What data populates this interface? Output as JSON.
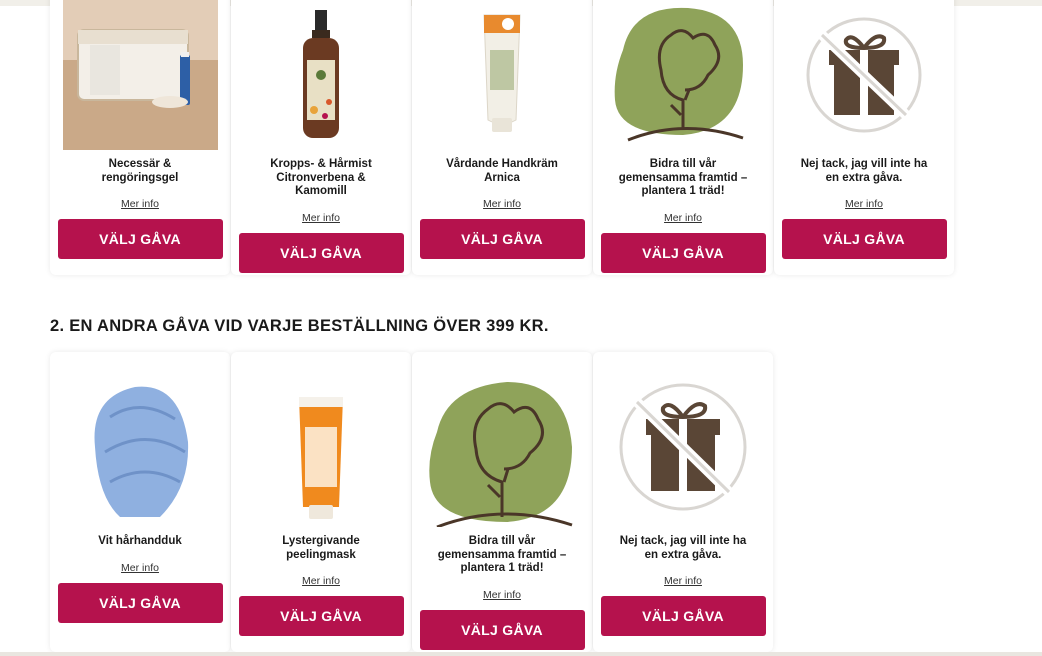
{
  "section1": {
    "products": [
      {
        "name": "Necessär & rengöringsgel",
        "more": "Mer info",
        "button": "VÄLJ GÅVA",
        "icon": "toiletry-bag-image"
      },
      {
        "name": "Kropps- & Hårmist Citronverbena & Kamomill",
        "more": "Mer info",
        "button": "VÄLJ GÅVA",
        "icon": "spray-bottle-image"
      },
      {
        "name": "Vårdande Handkräm Arnica",
        "more": "Mer info",
        "button": "VÄLJ GÅVA",
        "icon": "hand-cream-tube-image"
      },
      {
        "name": "Bidra till vår gemensamma framtid – plantera 1 träd!",
        "more": "Mer info",
        "button": "VÄLJ GÅVA",
        "icon": "tree-icon"
      },
      {
        "name": "Nej tack, jag vill inte ha en extra gåva.",
        "more": "Mer info",
        "button": "VÄLJ GÅVA",
        "icon": "no-gift-icon"
      }
    ]
  },
  "section2": {
    "title": "2. EN ANDRA GÅVA VID VARJE BESTÄLLNING ÖVER 399 KR.",
    "products": [
      {
        "name": "Vit hårhandduk",
        "more": "Mer info",
        "button": "VÄLJ GÅVA",
        "icon": "hair-towel-image"
      },
      {
        "name": "Lystergivande peelingmask",
        "more": "Mer info",
        "button": "VÄLJ GÅVA",
        "icon": "peeling-mask-tube-image"
      },
      {
        "name": "Bidra till vår gemensamma framtid – plantera 1 träd!",
        "more": "Mer info",
        "button": "VÄLJ GÅVA",
        "icon": "tree-icon"
      },
      {
        "name": "Nej tack, jag vill inte ha en extra gåva.",
        "more": "Mer info",
        "button": "VÄLJ GÅVA",
        "icon": "no-gift-icon"
      }
    ]
  },
  "colors": {
    "button": "#b5124d",
    "tree_blob": "#8fa35a",
    "gift_brown": "#5a4636"
  }
}
